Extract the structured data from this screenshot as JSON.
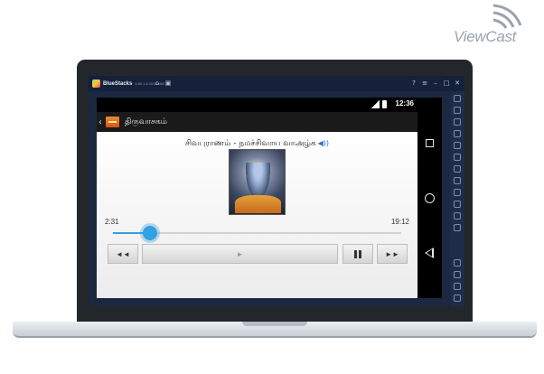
{
  "watermark": {
    "brand": "ViewCast"
  },
  "bluestacks": {
    "name": "BlueStacks",
    "version": "4.60.1.6.1023 N64",
    "title_icons": [
      "home-icon",
      "multi-instance-icon"
    ],
    "window_controls": [
      "help-icon",
      "menu-icon",
      "minimize-icon",
      "maximize-icon",
      "close-icon"
    ],
    "sidebar_icons": [
      "fullscreen-icon",
      "volume-up-icon",
      "volume-down-icon",
      "screen-record-icon",
      "screenshot-icon",
      "rotate-icon",
      "shake-icon",
      "keyboard-icon",
      "macro-icon",
      "multi-instance-icon",
      "location-icon",
      "eco-mode-icon",
      "settings-icon",
      "back-icon",
      "home-icon",
      "recents-icon"
    ]
  },
  "android": {
    "status": {
      "time": "12:36"
    },
    "action_bar": {
      "title": "திருவாசகம்"
    },
    "player": {
      "song_title": "சிவபுராணம் - நமச்சிவாய வாஅழ்க",
      "speaker_icon": "speaker-icon",
      "elapsed": "2:31",
      "duration": "19:12",
      "progress": 0.13,
      "buttons": {
        "prev": "◄◄",
        "bar": "►",
        "next": "►►"
      }
    },
    "nav": [
      "recents-icon",
      "home-icon",
      "back-icon"
    ]
  },
  "colors": {
    "accent": "#33a0e0",
    "app_icon": "#e06f24",
    "bezel": "#23272b",
    "bluestacks_bg": "#1b2840"
  }
}
